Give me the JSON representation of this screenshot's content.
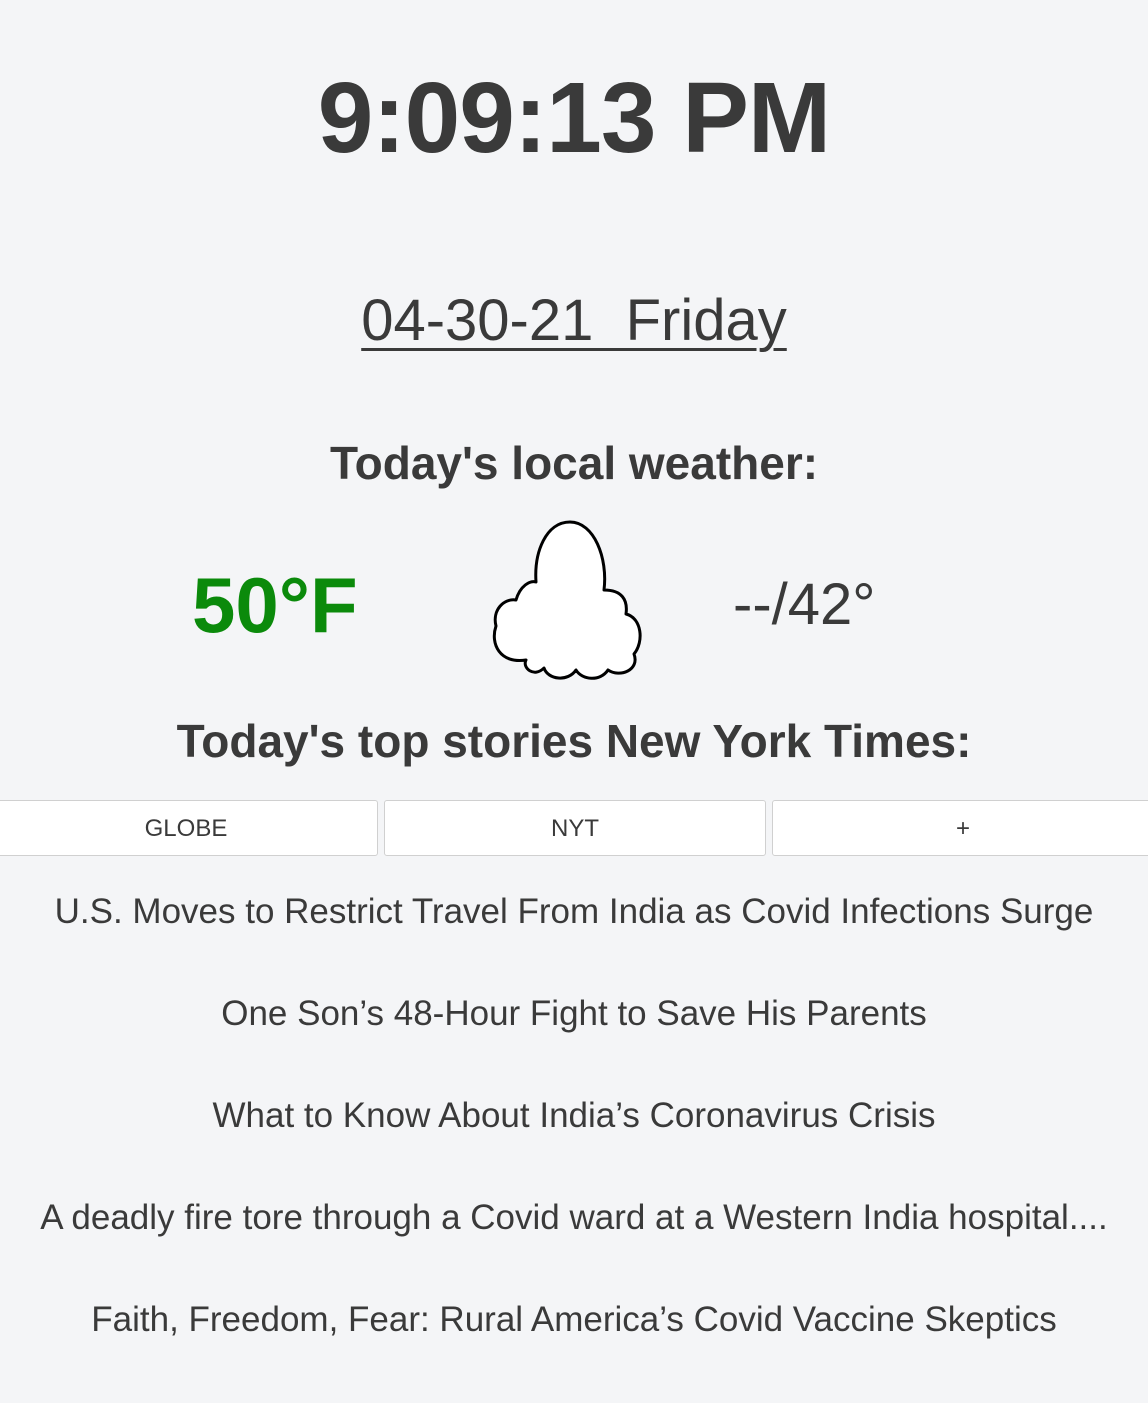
{
  "clock": {
    "time": "9:09:13 PM"
  },
  "date": {
    "text": "04-30-21  Friday"
  },
  "weather": {
    "heading": "Today's local weather:",
    "temperature": "50°F",
    "temperature_color": "#0b8a0b",
    "condition_icon": "cloud-icon",
    "hi_lo": "--/42°"
  },
  "stories": {
    "heading": "Today's top stories New York Times:",
    "tabs": [
      {
        "label": "GLOBE"
      },
      {
        "label": "NYT"
      },
      {
        "label": "+"
      }
    ],
    "items": [
      {
        "title": "U.S. Moves to Restrict Travel From India as Covid Infections Surge"
      },
      {
        "title": "One Son’s 48-Hour Fight to Save His Parents"
      },
      {
        "title": "What to Know About India’s Coronavirus Crisis"
      },
      {
        "title": "A deadly fire tore through a Covid ward at a Western India hospital...."
      },
      {
        "title": "Faith, Freedom, Fear: Rural America’s Covid Vaccine Skeptics"
      }
    ]
  }
}
